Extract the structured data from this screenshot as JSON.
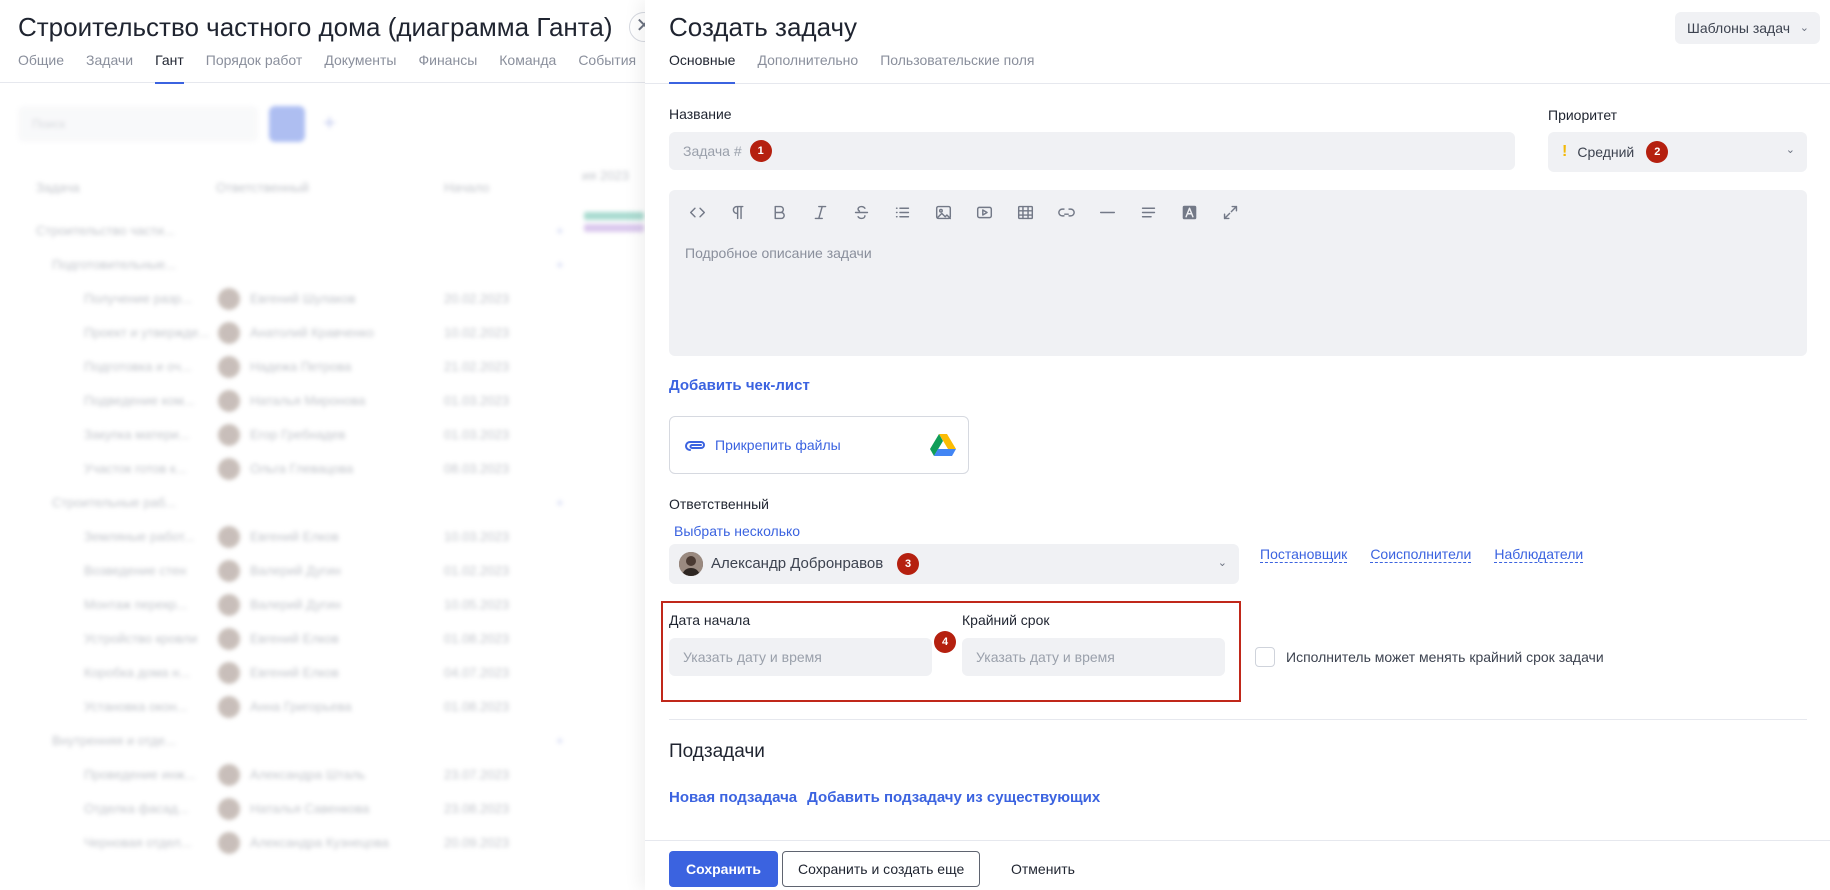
{
  "background": {
    "title": "Строительство частного дома (диаграмма Ганта)",
    "tabs": [
      "Общие",
      "Задачи",
      "Гант",
      "Порядок работ",
      "Документы",
      "Финансы",
      "Команда",
      "События"
    ],
    "active_tab": "Гант",
    "search_placeholder": "Поиск",
    "columns": [
      "Задача",
      "Ответственный",
      "Начало"
    ],
    "gantt_month": "ия 2023",
    "rows": [
      {
        "task": "Строительство части...",
        "person": "",
        "date": ""
      },
      {
        "task": "Подготовительные...",
        "person": "",
        "date": ""
      },
      {
        "task": "Получение разр...",
        "person": "Евгений Шулаков",
        "date": "20.02.2023"
      },
      {
        "task": "Проект и утвержде...",
        "person": "Анатолий Кравченко",
        "date": "10.02.2023"
      },
      {
        "task": "Подготовка и оч...",
        "person": "Надежа Петрова",
        "date": "21.02.2023"
      },
      {
        "task": "Подведение ком...",
        "person": "Наталья Миронова",
        "date": "01.03.2023"
      },
      {
        "task": "Закупка матери...",
        "person": "Егор Гребнадев",
        "date": "01.03.2023"
      },
      {
        "task": "Участок готов к...",
        "person": "Ольга Глевацова",
        "date": "08.03.2023"
      },
      {
        "task": "Строительные раб...",
        "person": "",
        "date": ""
      },
      {
        "task": "Земляные работ...",
        "person": "Евгений Елков",
        "date": "10.03.2023"
      },
      {
        "task": "Возведение стен",
        "person": "Валерий Дугин",
        "date": "01.02.2023"
      },
      {
        "task": "Монтаж перекр...",
        "person": "Валерий Дугин",
        "date": "10.05.2023"
      },
      {
        "task": "Устройство кровли",
        "person": "Евгений Елков",
        "date": "01.08.2023"
      },
      {
        "task": "Коробка дома н...",
        "person": "Евгений Елков",
        "date": "04.07.2023"
      },
      {
        "task": "Установка окон...",
        "person": "Анна Григорьева",
        "date": "01.08.2023"
      },
      {
        "task": "Внутренняя и отде...",
        "person": "",
        "date": ""
      },
      {
        "task": "Проведение инж...",
        "person": "Александра Шталь",
        "date": "23.07.2023"
      },
      {
        "task": "Отделка фасад...",
        "person": "Наталья Савенкова",
        "date": "23.08.2023"
      },
      {
        "task": "Черновая отдел...",
        "person": "Александра Кузнецова",
        "date": "20.09.2023"
      }
    ]
  },
  "drawer": {
    "title": "Создать задачу",
    "tabs": [
      "Основные",
      "Дополнительно",
      "Пользовательские поля"
    ],
    "active_tab": "Основные",
    "templates_label": "Шаблоны задач",
    "name": {
      "label": "Название",
      "placeholder": "Задача #",
      "marker": "1"
    },
    "priority": {
      "label": "Приоритет",
      "value": "Средний",
      "icon": "!",
      "marker": "2"
    },
    "editor": {
      "placeholder": "Подробное описание задачи",
      "tools": [
        "code-icon",
        "paragraph-icon",
        "bold-icon",
        "italic-icon",
        "strikethrough-icon",
        "bullet-list-icon",
        "image-icon",
        "video-icon",
        "table-icon",
        "link-icon",
        "horizontal-rule-icon",
        "align-icon",
        "text-color-icon",
        "expand-icon"
      ]
    },
    "checklist_link": "Добавить чек-лист",
    "attach_label": "Прикрепить файлы",
    "responsible": {
      "label": "Ответственный",
      "multi_link": "Выбрать несколько",
      "value": "Александр Добронравов",
      "marker": "3",
      "links": [
        "Постановщик",
        "Соисполнители",
        "Наблюдатели"
      ]
    },
    "start_date": {
      "label": "Дата начала",
      "placeholder": "Указать дату и время"
    },
    "deadline": {
      "label": "Крайний срок",
      "placeholder": "Указать дату и время"
    },
    "dates_marker": "4",
    "deadline_checkbox_label": "Исполнитель может менять крайний срок задачи",
    "subtasks": {
      "title": "Подзадачи",
      "new_link": "Новая подзадача",
      "add_existing_link": "Добавить подзадачу из существующих"
    },
    "footer": {
      "save": "Сохранить",
      "save_and_new": "Сохранить и создать еще",
      "cancel": "Отменить"
    }
  },
  "colors": {
    "accent": "#3b63e0",
    "marker": "#b5200f",
    "highlight": "#c0281a",
    "field_bg": "#f0f1f4",
    "priority": "#f2b807"
  }
}
